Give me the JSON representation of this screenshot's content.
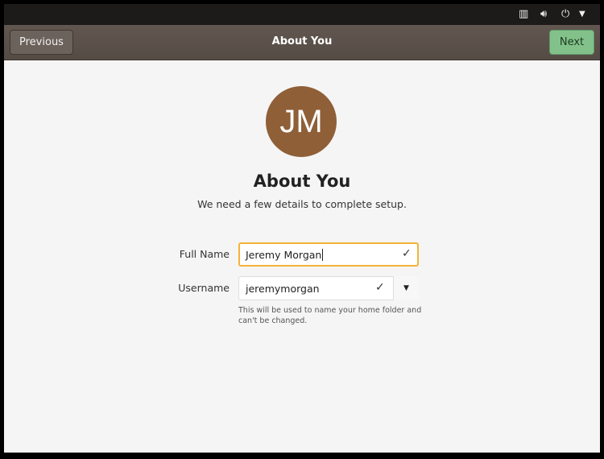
{
  "top_panel": {
    "icons": [
      "network-icon",
      "volume-icon",
      "power-icon",
      "menu-arrow-icon"
    ]
  },
  "header": {
    "previous_label": "Previous",
    "title": "About You",
    "next_label": "Next"
  },
  "main": {
    "avatar_initials": "JM",
    "avatar_color": "#8f5f38",
    "heading": "About You",
    "subtitle": "We need a few details to complete setup.",
    "full_name": {
      "label": "Full Name",
      "value": "Jeremy Morgan"
    },
    "username": {
      "label": "Username",
      "value": "jeremymorgan",
      "hint": "This will be used to name your home folder and can't be changed."
    }
  }
}
